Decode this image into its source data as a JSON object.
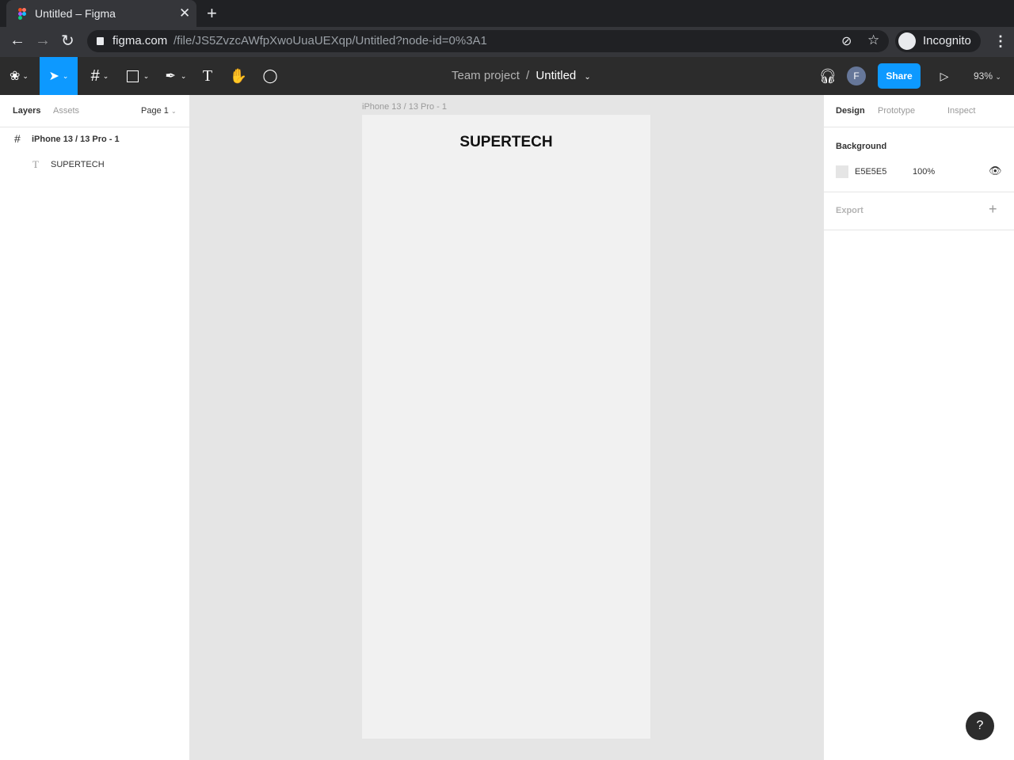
{
  "browser": {
    "tab_title": "Untitled – Figma",
    "url_host": "figma.com",
    "url_path": "/file/JS5ZvzcAWfpXwoUuaUEXqp/Untitled?node-id=0%3A1",
    "profile": "Incognito"
  },
  "toolbar": {
    "project": "Team project",
    "separator": "/",
    "file": "Untitled",
    "avatar": "F",
    "share": "Share",
    "zoom": "93%"
  },
  "left_panel": {
    "tabs": [
      "Layers",
      "Assets"
    ],
    "page": "Page 1",
    "layers": [
      {
        "name": "iPhone 13 / 13 Pro - 1",
        "type": "frame"
      },
      {
        "name": "SUPERTECH",
        "type": "text"
      }
    ]
  },
  "canvas": {
    "frame_label": "iPhone 13 / 13 Pro - 1",
    "frame_text": "SUPERTECH"
  },
  "right_panel": {
    "tabs": [
      "Design",
      "Prototype",
      "Inspect"
    ],
    "background_title": "Background",
    "bg_hex": "E5E5E5",
    "bg_opacity": "100%",
    "export_title": "Export"
  },
  "help": "?"
}
